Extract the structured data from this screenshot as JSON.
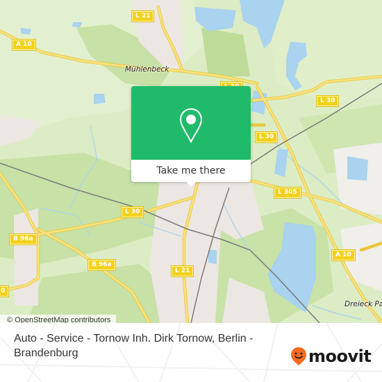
{
  "map": {
    "colors": {
      "land": "#dcecc4",
      "forest": "#c7e1a6",
      "urban": "#ece7e2",
      "water": "#a9d3ee",
      "road": "#f6dc5a",
      "rail": "#777777"
    },
    "road_labels": [
      {
        "id": "l21-north",
        "text": "L 21"
      },
      {
        "id": "a10-west",
        "text": "A 10"
      },
      {
        "id": "l30-top",
        "text": "L 30"
      },
      {
        "id": "l30-east",
        "text": "L 30"
      },
      {
        "id": "l30-mid",
        "text": "L 30"
      },
      {
        "id": "l305",
        "text": "L 305"
      },
      {
        "id": "b96a-west",
        "text": "B 96a"
      },
      {
        "id": "b96a-south",
        "text": "B 96a"
      },
      {
        "id": "l21-south",
        "text": "L 21"
      },
      {
        "id": "a10-east",
        "text": "A 10"
      },
      {
        "id": "edge-west",
        "text": "0"
      }
    ],
    "place_labels": [
      {
        "id": "muehlenbeck",
        "text": "Mühlenbeck"
      },
      {
        "id": "dreieck",
        "text": "Dreieck Pa"
      }
    ],
    "attribution": "© OpenStreetMap contributors"
  },
  "popup": {
    "icon": "map-pin-icon",
    "action_label": "Take me there",
    "accent_color": "#1fbb6a"
  },
  "footer": {
    "place_title": "Auto - Service - Tornow Inh. Dirk Tornow, Berlin - Brandenburg",
    "logo_text": "moovit",
    "logo_icon": "moovit-smiley-pin-icon",
    "logo_color": "#f26b21"
  }
}
